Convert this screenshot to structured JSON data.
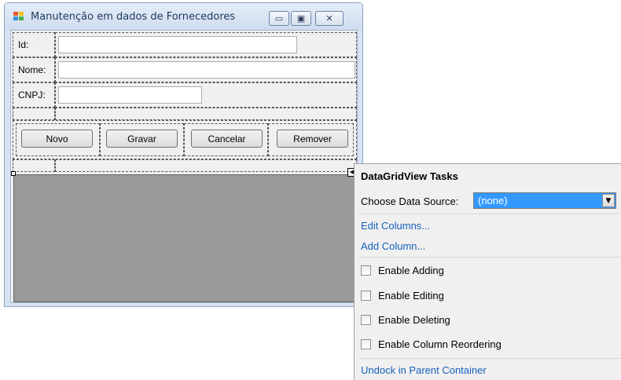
{
  "window": {
    "title": "Manutenção em dados de Fornecedores",
    "minimize_glyph": "▭",
    "maximize_glyph": "▣",
    "close_glyph": "✕"
  },
  "form": {
    "id_label": "Id:",
    "nome_label": "Nome:",
    "cnpj_label": "CNPJ:",
    "id_value": "",
    "nome_value": "",
    "cnpj_value": "",
    "buttons": {
      "novo": "Novo",
      "gravar": "Gravar",
      "cancelar": "Cancelar",
      "remover": "Remover"
    },
    "smart_tag_glyph": "◀"
  },
  "tasks": {
    "title": "DataGridView Tasks",
    "choose_data_source_label": "Choose Data Source:",
    "data_source_value": "(none)",
    "combo_arrow_glyph": "▼",
    "edit_columns": "Edit Columns...",
    "add_column": "Add Column...",
    "checkboxes": [
      {
        "label": "Enable Adding",
        "checked": false
      },
      {
        "label": "Enable Editing",
        "checked": false
      },
      {
        "label": "Enable Deleting",
        "checked": false
      },
      {
        "label": "Enable Column Reordering",
        "checked": false
      }
    ],
    "undock": "Undock in Parent Container"
  },
  "colors": {
    "selection": "#3399ff",
    "link": "#1560bd",
    "grid_bg": "#9a9a9a"
  }
}
